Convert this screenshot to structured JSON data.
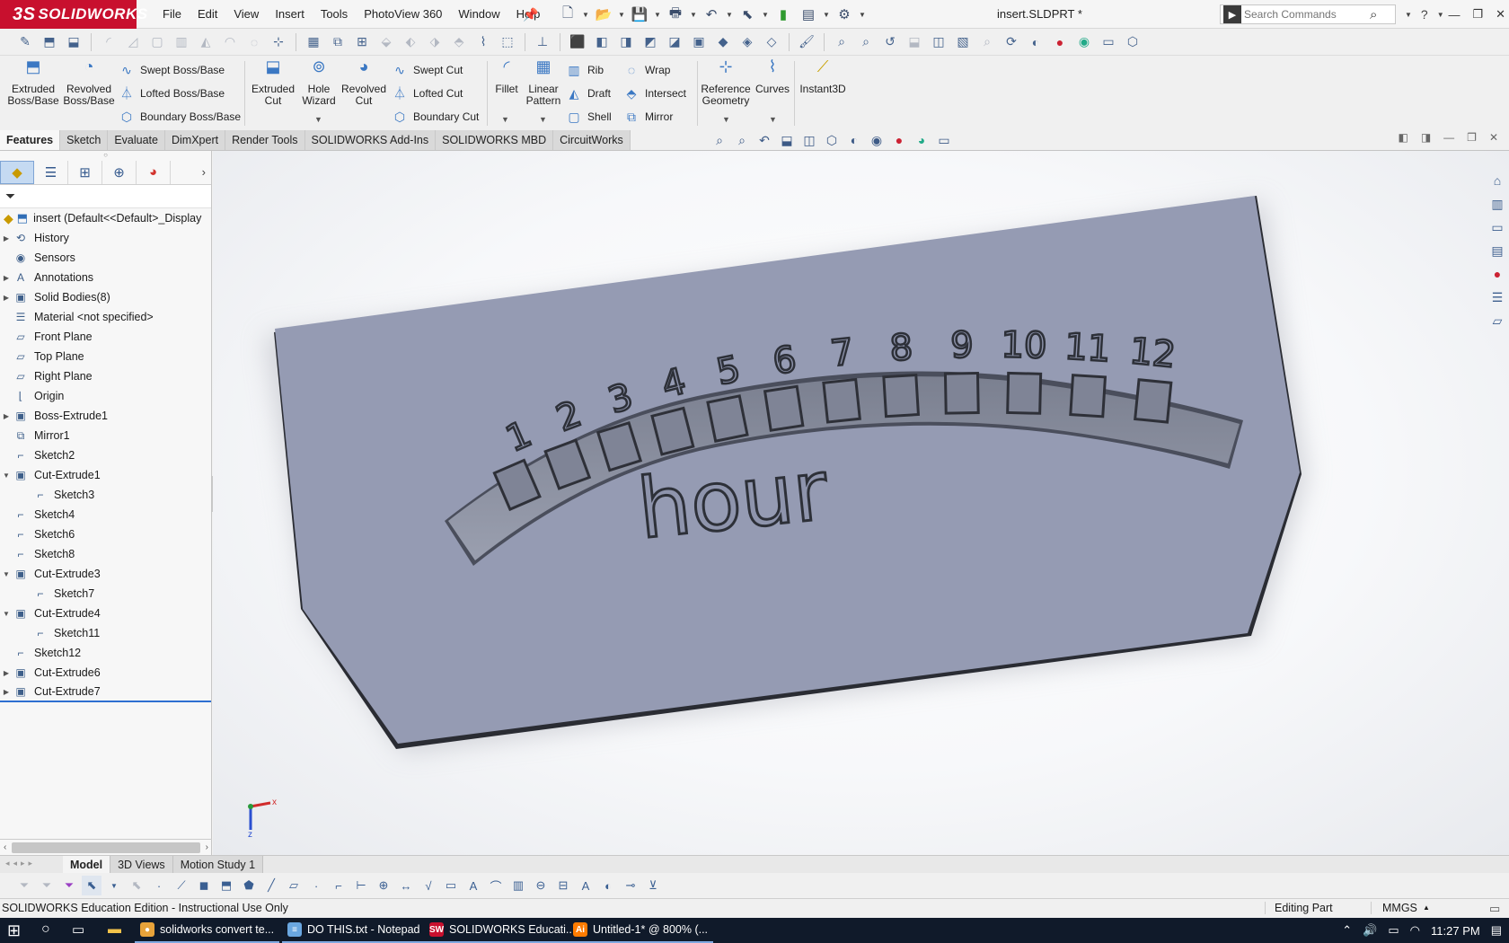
{
  "titlebar": {
    "logo_prefix": "3S",
    "logo_text": "SOLIDWORKS",
    "menus": [
      "File",
      "Edit",
      "View",
      "Insert",
      "Tools",
      "PhotoView 360",
      "Window",
      "Help"
    ],
    "document_title": "insert.SLDPRT *",
    "search_placeholder": "Search Commands",
    "help_label": "?"
  },
  "command_manager": {
    "extruded_boss": "Extruded Boss/Base",
    "revolved_boss": "Revolved Boss/Base",
    "swept_boss": "Swept Boss/Base",
    "lofted_boss": "Lofted Boss/Base",
    "boundary_boss": "Boundary Boss/Base",
    "extruded_cut": "Extruded Cut",
    "hole_wizard": "Hole Wizard",
    "revolved_cut": "Revolved Cut",
    "swept_cut": "Swept Cut",
    "lofted_cut": "Lofted Cut",
    "boundary_cut": "Boundary Cut",
    "fillet": "Fillet",
    "linear_pattern": "Linear Pattern",
    "rib": "Rib",
    "draft": "Draft",
    "shell": "Shell",
    "wrap": "Wrap",
    "intersect": "Intersect",
    "mirror": "Mirror",
    "reference_geometry": "Reference Geometry",
    "curves": "Curves",
    "instant3d": "Instant3D"
  },
  "tabs": [
    "Features",
    "Sketch",
    "Evaluate",
    "DimXpert",
    "Render Tools",
    "SOLIDWORKS Add-Ins",
    "SOLIDWORKS MBD",
    "CircuitWorks"
  ],
  "tree": {
    "root": "insert  (Default<<Default>_Display",
    "items": [
      {
        "label": "History",
        "expand": "▶",
        "icon": "history-icon",
        "glyph": "⟲",
        "child": false
      },
      {
        "label": "Sensors",
        "expand": "",
        "icon": "sensor-icon",
        "glyph": "◉",
        "child": false
      },
      {
        "label": "Annotations",
        "expand": "▶",
        "icon": "annotation-icon",
        "glyph": "A",
        "child": false
      },
      {
        "label": "Solid Bodies(8)",
        "expand": "▶",
        "icon": "solid-bodies-icon",
        "glyph": "▣",
        "child": false
      },
      {
        "label": "Material <not specified>",
        "expand": "",
        "icon": "material-icon",
        "glyph": "☰",
        "child": false
      },
      {
        "label": "Front Plane",
        "expand": "",
        "icon": "plane-icon",
        "glyph": "▱",
        "child": false
      },
      {
        "label": "Top Plane",
        "expand": "",
        "icon": "plane-icon",
        "glyph": "▱",
        "child": false
      },
      {
        "label": "Right Plane",
        "expand": "",
        "icon": "plane-icon",
        "glyph": "▱",
        "child": false
      },
      {
        "label": "Origin",
        "expand": "",
        "icon": "origin-icon",
        "glyph": "⌊",
        "child": false
      },
      {
        "label": "Boss-Extrude1",
        "expand": "▶",
        "icon": "extrude-icon",
        "glyph": "▣",
        "child": false
      },
      {
        "label": "Mirror1",
        "expand": "",
        "icon": "mirror-icon",
        "glyph": "⧉",
        "child": false
      },
      {
        "label": "Sketch2",
        "expand": "",
        "icon": "sketch-icon",
        "glyph": "⌐",
        "child": false
      },
      {
        "label": "Cut-Extrude1",
        "expand": "▼",
        "icon": "cut-extrude-icon",
        "glyph": "▣",
        "child": false
      },
      {
        "label": "Sketch3",
        "expand": "",
        "icon": "sketch-icon",
        "glyph": "⌐",
        "child": true
      },
      {
        "label": "Sketch4",
        "expand": "",
        "icon": "sketch-icon",
        "glyph": "⌐",
        "child": false
      },
      {
        "label": "Sketch6",
        "expand": "",
        "icon": "sketch-icon",
        "glyph": "⌐",
        "child": false
      },
      {
        "label": "Sketch8",
        "expand": "",
        "icon": "sketch-icon",
        "glyph": "⌐",
        "child": false
      },
      {
        "label": "Cut-Extrude3",
        "expand": "▼",
        "icon": "cut-extrude-icon",
        "glyph": "▣",
        "child": false
      },
      {
        "label": "Sketch7",
        "expand": "",
        "icon": "sketch-icon",
        "glyph": "⌐",
        "child": true
      },
      {
        "label": "Cut-Extrude4",
        "expand": "▼",
        "icon": "cut-extrude-icon",
        "glyph": "▣",
        "child": false
      },
      {
        "label": "Sketch11",
        "expand": "",
        "icon": "sketch-icon",
        "glyph": "⌐",
        "child": true
      },
      {
        "label": "Sketch12",
        "expand": "",
        "icon": "sketch-icon",
        "glyph": "⌐",
        "child": false
      },
      {
        "label": "Cut-Extrude6",
        "expand": "▶",
        "icon": "cut-extrude-icon",
        "glyph": "▣",
        "child": false
      },
      {
        "label": "Cut-Extrude7",
        "expand": "▶",
        "icon": "cut-extrude-icon",
        "glyph": "▣",
        "child": false
      }
    ]
  },
  "model": {
    "dial_numbers": [
      "1",
      "2",
      "3",
      "4",
      "5",
      "6",
      "7",
      "8",
      "9",
      "10",
      "11",
      "12"
    ],
    "dial_label": "hour",
    "part_color": "#959bb3",
    "triad_x": "x",
    "triad_y": "y",
    "triad_z": "z"
  },
  "bottom_tabs": [
    "Model",
    "3D Views",
    "Motion Study 1"
  ],
  "status": {
    "edition": "SOLIDWORKS Education Edition - Instructional Use Only",
    "mode": "Editing Part",
    "units": "MMGS"
  },
  "taskbar": {
    "apps": [
      {
        "label": "solidworks convert te...",
        "icon": "chrome-icon",
        "glyph": "●",
        "color": "#e8a33a"
      },
      {
        "label": "DO THIS.txt - Notepad",
        "icon": "notepad-icon",
        "glyph": "≡",
        "color": "#6aa7e0"
      },
      {
        "label": "SOLIDWORKS Educati...",
        "icon": "solidworks-icon",
        "glyph": "SW",
        "color": "#c8102e"
      },
      {
        "label": "Untitled-1* @ 800% (...",
        "icon": "illustrator-icon",
        "glyph": "Ai",
        "color": "#ff7c00"
      }
    ],
    "time": "11:27 PM"
  }
}
